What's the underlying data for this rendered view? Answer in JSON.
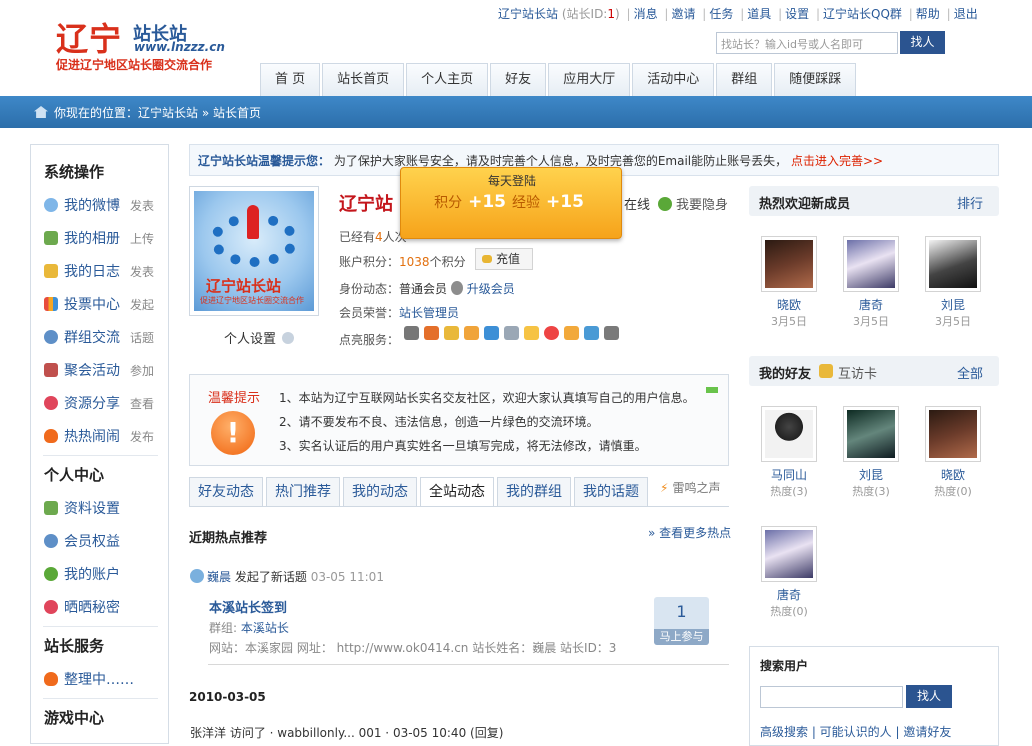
{
  "logo": {
    "big": "辽宁",
    "tag": "站长站",
    "url": "www.lnzzz.cn",
    "slogan": "促进辽宁地区站长圈交流合作"
  },
  "topbar": {
    "site": "辽宁站长站",
    "id_label": "(站长ID:",
    "id_value": "1",
    "id_close": ")",
    "links": [
      "消息",
      "邀请",
      "任务",
      "道具",
      "设置",
      "辽宁站长QQ群",
      "帮助",
      "退出"
    ]
  },
  "search_top": {
    "placeholder": "找站长？输入id号或人名即可",
    "button": "找人"
  },
  "nav": [
    "首 页",
    "站长首页",
    "个人主页",
    "好友",
    "应用大厅",
    "活动中心",
    "群组",
    "随便踩踩"
  ],
  "breadcrumb": {
    "text": "你现在的位置：辽宁站长站 » 站长首页"
  },
  "sidebar": {
    "system_title": "系统操作",
    "system_items": [
      {
        "label": "我的微博",
        "sub": "发表"
      },
      {
        "label": "我的相册",
        "sub": "上传"
      },
      {
        "label": "我的日志",
        "sub": "发表"
      },
      {
        "label": "投票中心",
        "sub": "发起"
      },
      {
        "label": "群组交流",
        "sub": "话题"
      },
      {
        "label": "聚会活动",
        "sub": "参加"
      },
      {
        "label": "资源分享",
        "sub": "查看"
      },
      {
        "label": "热热闹闹",
        "sub": "发布"
      }
    ],
    "personal_title": "个人中心",
    "personal_items": [
      "资料设置",
      "会员权益",
      "我的账户",
      "晒晒秘密"
    ],
    "service_title": "站长服务",
    "service_items": [
      "整理中……"
    ],
    "game_title": "游戏中心"
  },
  "notice": {
    "title": "辽宁站长站温馨提示您：",
    "text": "为了保护大家账号安全，请及时完善个人信息，及时完善您的Email能防止账号丢失，",
    "link": "点击进入完善>>"
  },
  "avatar": {
    "brand": "辽宁站长站",
    "brand_sub": "促进辽宁地区站长圈交流合作",
    "setting": "个人设置"
  },
  "profile": {
    "name": "辽宁站",
    "online": "在线",
    "hide": "我要隐身",
    "visits_pre": "已经有",
    "visits_n": "4",
    "visits_post": "人次",
    "points_label": "账户积分：",
    "points_n": "1038",
    "points_unit": "个积分",
    "charge": "充值",
    "identity_label": "身份动态：",
    "identity": "普通会员",
    "upgrade": "升级会员",
    "honor_label": "会员荣誉：",
    "honor": "站长管理员",
    "services_label": "点亮服务："
  },
  "popup": {
    "title": "每天登陆",
    "jifen_label": "积分",
    "jifen": "+15",
    "exp_label": "经验",
    "exp": "+15"
  },
  "tip": {
    "label": "温馨提示",
    "lines": [
      "1、本站为辽宁互联网站长实名交友社区，欢迎大家认真填写自己的用户信息。",
      "2、请不要发布不良、违法信息，创造一片绿色的交流环境。",
      "3、实名认证后的用户真实姓名一旦填写完成，将无法修改，请慎重。"
    ]
  },
  "tabs": [
    "好友动态",
    "热门推荐",
    "我的动态",
    "全站动态",
    "我的群组",
    "我的话题"
  ],
  "leiming": "雷鸣之声",
  "hot": {
    "title": "近期热点推荐",
    "more": "» 查看更多热点"
  },
  "feed1": {
    "user": "巍晨",
    "action": "发起了新话题",
    "time": "03-05 11:01",
    "topic": "本溪站长签到",
    "group_label": "群组:",
    "group": "本溪站长",
    "site": "网站：本溪家园  网址：  http://www.ok0414.cn 站长姓名：巍晨  站长ID：3",
    "count": "1",
    "join": "马上参与"
  },
  "date": "2010-03-05",
  "feed2": "张洋洋   访问了 · wabbillonly... 001  · 03-05 10:40 (回复)",
  "right": {
    "new_title": "热烈欢迎新成员",
    "new_more": "排行",
    "new_members": [
      {
        "name": "晓欧",
        "date": "3月5日"
      },
      {
        "name": "唐奇",
        "date": "3月5日"
      },
      {
        "name": "刘昆",
        "date": "3月5日"
      }
    ],
    "friends_title": "我的好友",
    "friends_visit": "互访卡",
    "friends_more": "全部",
    "friends": [
      {
        "name": "马同山",
        "heat": "热度(3)"
      },
      {
        "name": "刘昆",
        "heat": "热度(3)"
      },
      {
        "name": "晓欧",
        "heat": "热度(0)"
      },
      {
        "name": "唐奇",
        "heat": "热度(0)"
      }
    ],
    "search_title": "搜索用户",
    "search_btn": "找人",
    "search_links": "高级搜索 | 可能认识的人 | 邀请好友"
  },
  "colors": {
    "accent": "#2b5490",
    "brand_red": "#d9301b",
    "bar_blue": "#3e88c8"
  }
}
